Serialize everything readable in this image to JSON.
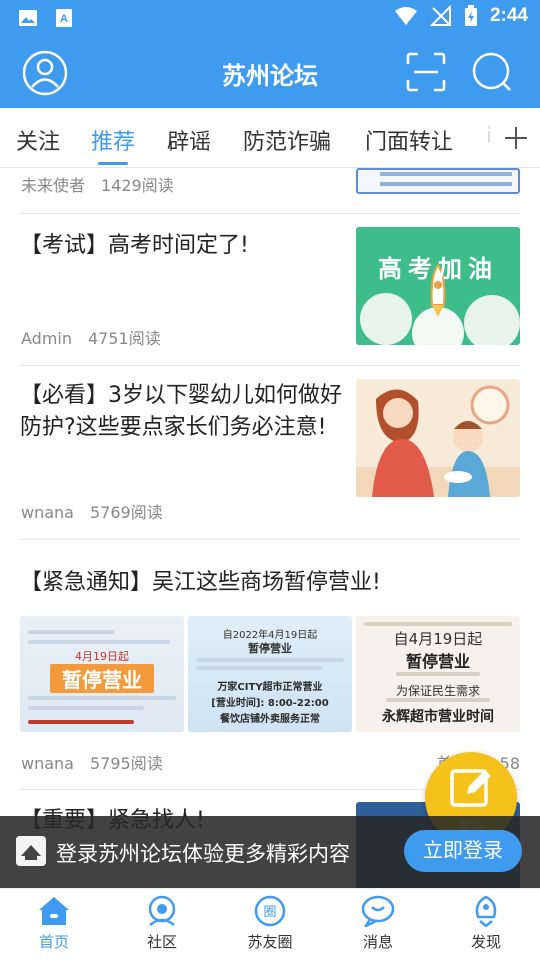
{
  "status_bar": {
    "time": "2:44"
  },
  "header": {
    "title": "苏州论坛"
  },
  "tabs": [
    {
      "label": "关注"
    },
    {
      "label": "推荐"
    },
    {
      "label": "辟谣"
    },
    {
      "label": "防范诈骗"
    },
    {
      "label": "门面转让"
    },
    {
      "label": "i"
    }
  ],
  "feed": {
    "partial": {
      "author": "未来使者",
      "views": "1429阅读"
    },
    "posts": [
      {
        "title": "【考试】高考时间定了!",
        "author": "Admin",
        "views": "4751阅读",
        "thumb_text": "高考加油"
      },
      {
        "title": "【必看】3岁以下婴幼儿如何做好防护?这些要点家长们务必注意!",
        "author": "wnana",
        "views": "5769阅读"
      },
      {
        "title": "【紧急通知】吴江这些商场暂停营业!",
        "author": "wnana",
        "views": "5795阅读",
        "time": "首页 11:58",
        "posters": [
          {
            "big": "暂停营业",
            "sub": "4月19日起"
          },
          {
            "head": "自2022年4月19日起",
            "big": "暂停营业",
            "line1": "万家CITY超市正常营业",
            "line2": "[营业时间]: 8:00-22:00",
            "line3": "餐饮店铺外卖服务正常"
          },
          {
            "head": "自4月19日起",
            "big": "暂停营业",
            "line1": "为保证民生需求",
            "line2": "永辉超市营业时间"
          }
        ]
      },
      {
        "title": "【重要】紧急找人!"
      }
    ]
  },
  "banner": {
    "text": "登录苏州论坛体验更多精彩内容",
    "button": "立即登录"
  },
  "fab": {
    "label": "发帖"
  },
  "bottom_nav": [
    {
      "label": "首页",
      "icon": "home-icon",
      "active": true
    },
    {
      "label": "社区",
      "icon": "community-icon"
    },
    {
      "label": "苏友圈",
      "icon": "circle-icon"
    },
    {
      "label": "消息",
      "icon": "message-icon"
    },
    {
      "label": "发现",
      "icon": "discover-icon"
    }
  ],
  "colors": {
    "brand": "#3f9bf0",
    "fab": "#f4c21a",
    "banner_bg": "#282828"
  }
}
